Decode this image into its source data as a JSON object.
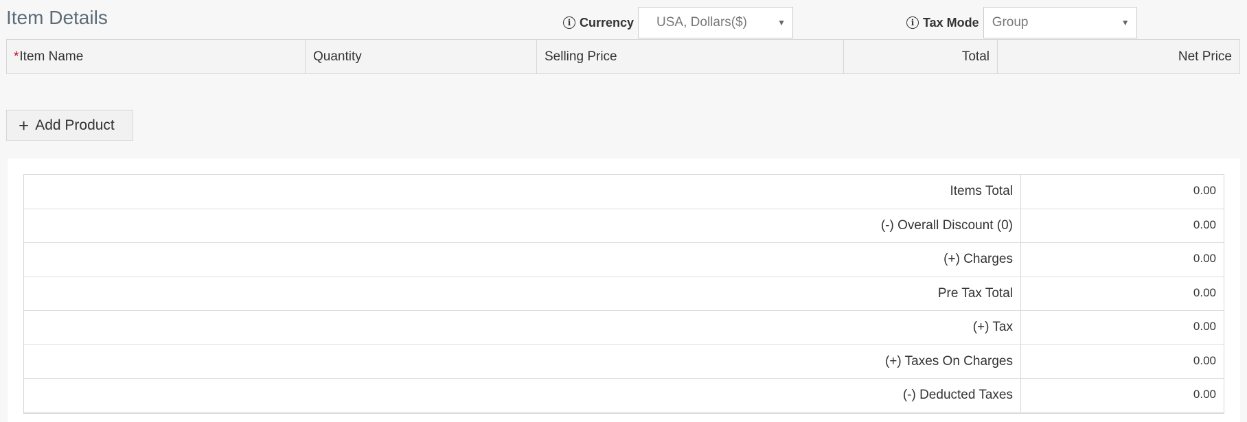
{
  "section": {
    "title": "Item Details"
  },
  "currency": {
    "label": "Currency",
    "value": "USA, Dollars($)"
  },
  "tax_mode": {
    "label": "Tax Mode",
    "value": "Group"
  },
  "items_table": {
    "required_marker": "*",
    "columns": [
      "Item Name",
      "Quantity",
      "Selling Price",
      "Total",
      "Net Price"
    ]
  },
  "add_product": {
    "icon": "+",
    "label": "Add Product"
  },
  "summary": {
    "rows": [
      {
        "label": "Items Total",
        "value": "0.00"
      },
      {
        "label": "(-) Overall Discount (0)",
        "value": "0.00"
      },
      {
        "label": "(+) Charges",
        "value": "0.00"
      },
      {
        "label": "Pre Tax Total",
        "value": "0.00"
      },
      {
        "label": "(+) Tax",
        "value": "0.00"
      },
      {
        "label": "(+) Taxes On Charges",
        "value": "0.00"
      },
      {
        "label": "(-) Deducted Taxes",
        "value": "0.00"
      }
    ]
  },
  "icons": {
    "info": "i",
    "dropdown": "▼"
  }
}
